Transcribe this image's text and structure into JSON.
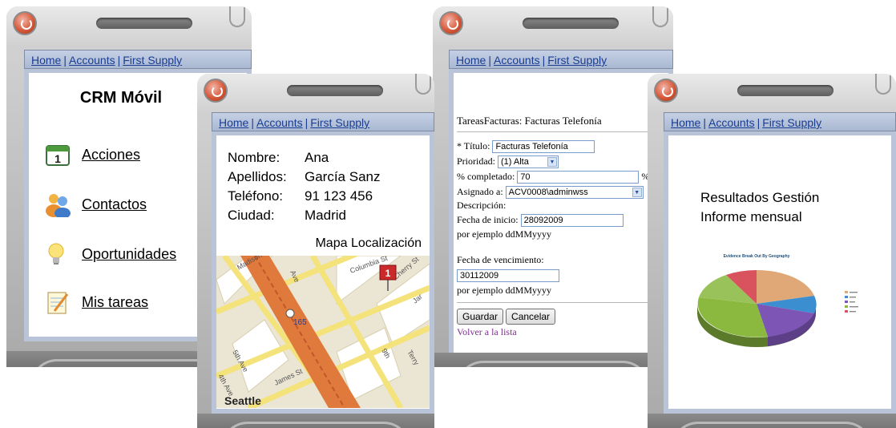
{
  "nav": {
    "home": "Home",
    "accounts": "Accounts",
    "first_supply": "First Supply",
    "separator": "|"
  },
  "phone1": {
    "title": "CRM Móvil",
    "menu": [
      {
        "label": "Acciones",
        "icon": "calendar-icon"
      },
      {
        "label": "Contactos",
        "icon": "people-icon"
      },
      {
        "label": "Oportunidades",
        "icon": "lightbulb-icon"
      },
      {
        "label": "Mis tareas",
        "icon": "notepad-icon"
      }
    ]
  },
  "phone2": {
    "fields": [
      {
        "key": "Nombre:",
        "value": "Ana"
      },
      {
        "key": "Apellidos:",
        "value": "García Sanz"
      },
      {
        "key": "Teléfono:",
        "value": "91 123 456"
      },
      {
        "key": "Ciudad:",
        "value": "Madrid"
      }
    ],
    "map_label": "Mapa Localización",
    "map": {
      "streets": [
        "Madison",
        "Ave",
        "Columbia St",
        "Cherry St",
        "5th Ave",
        "4th Ave",
        "James St",
        "Terry",
        "9th",
        "Jar"
      ],
      "city": "Seattle",
      "route_marker": "165",
      "pin_label": "1"
    }
  },
  "phone3": {
    "heading": "TareasFacturas: Facturas Telefonía",
    "titulo_label": "* Título:",
    "titulo_value": "Facturas Telefonía",
    "prioridad_label": "Prioridad:",
    "prioridad_value": "(1) Alta",
    "completado_label": "% completado:",
    "completado_value": "70",
    "percent_sign": "%",
    "asignado_label": "Asignado a:",
    "asignado_value": "ACV0008\\adminwss",
    "descripcion_label": "Descripción:",
    "inicio_label": "Fecha de inicio:",
    "inicio_value": "28092009",
    "inicio_hint": "por ejemplo ddMMyyyy",
    "vencimiento_label": "Fecha de vencimiento:",
    "vencimiento_value": "30112009",
    "vencimiento_hint": "por ejemplo ddMMyyyy",
    "guardar": "Guardar",
    "cancelar": "Cancelar",
    "volver": "Volver a la lista"
  },
  "phone4": {
    "title_line1": "Resultados Gestión",
    "title_line2": "Informe mensual",
    "chart_title": "Evidence Break Out By Geography",
    "chart_data": {
      "type": "pie",
      "title": "Evidence Break Out By Geography",
      "legend_position": "right"
    }
  },
  "colors": {
    "nav_link": "#1a3d91",
    "screen_border": "#b9c4d9",
    "volver_link": "#7a2f8e"
  }
}
